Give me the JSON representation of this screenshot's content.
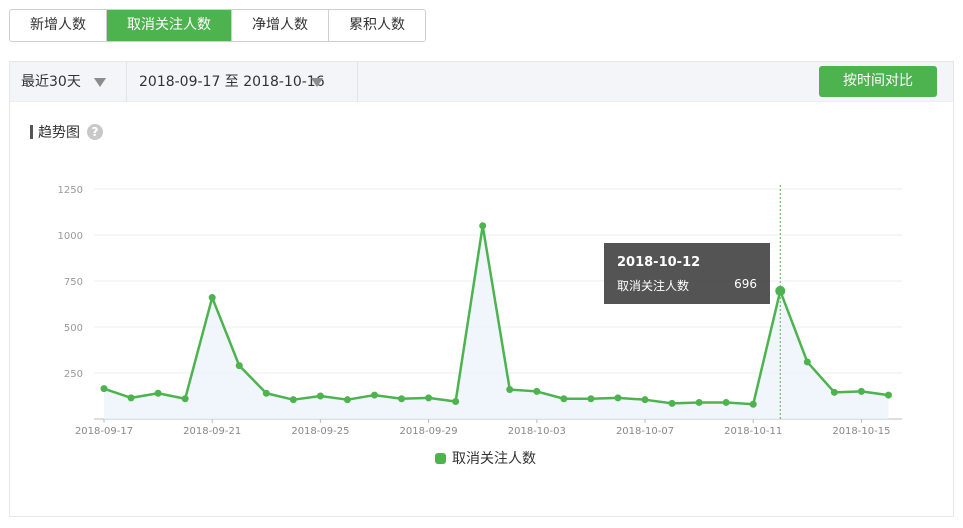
{
  "tabs": [
    {
      "label": "新增人数",
      "active": false
    },
    {
      "label": "取消关注人数",
      "active": true
    },
    {
      "label": "净增人数",
      "active": false
    },
    {
      "label": "累积人数",
      "active": false
    }
  ],
  "toolbar": {
    "range_label": "最近30天",
    "date_range": "2018-09-17 至 2018-10-16",
    "compare_button": "按时间对比"
  },
  "section": {
    "title": "趋势图",
    "help_glyph": "?"
  },
  "colors": {
    "accent": "#4db34f",
    "area": "#eef4fb",
    "grid": "#ececec"
  },
  "tooltip": {
    "date": "2018-10-12",
    "series": "取消关注人数",
    "value": "696"
  },
  "chart_data": {
    "type": "line",
    "y_ticks": [
      "250",
      "500",
      "750",
      "1000",
      "1250"
    ],
    "x_tick_labels": [
      "2018-09-17",
      "2018-09-21",
      "2018-09-25",
      "2018-09-29",
      "2018-10-03",
      "2018-10-07",
      "2018-10-11",
      "2018-10-15"
    ],
    "x": [
      "2018-09-17",
      "2018-09-18",
      "2018-09-19",
      "2018-09-20",
      "2018-09-21",
      "2018-09-22",
      "2018-09-23",
      "2018-09-24",
      "2018-09-25",
      "2018-09-26",
      "2018-09-27",
      "2018-09-28",
      "2018-09-29",
      "2018-09-30",
      "2018-10-01",
      "2018-10-02",
      "2018-10-03",
      "2018-10-04",
      "2018-10-05",
      "2018-10-06",
      "2018-10-07",
      "2018-10-08",
      "2018-10-09",
      "2018-10-10",
      "2018-10-11",
      "2018-10-12",
      "2018-10-13",
      "2018-10-14",
      "2018-10-15",
      "2018-10-16"
    ],
    "series": [
      {
        "name": "取消关注人数",
        "values": [
          165,
          115,
          140,
          110,
          660,
          290,
          140,
          105,
          125,
          105,
          130,
          110,
          115,
          95,
          1050,
          160,
          150,
          110,
          110,
          115,
          105,
          85,
          90,
          90,
          80,
          696,
          310,
          145,
          150,
          130
        ]
      }
    ],
    "ylim": [
      0,
      1250
    ],
    "highlight_index": 25,
    "grid": true,
    "legend_position": "bottom"
  }
}
